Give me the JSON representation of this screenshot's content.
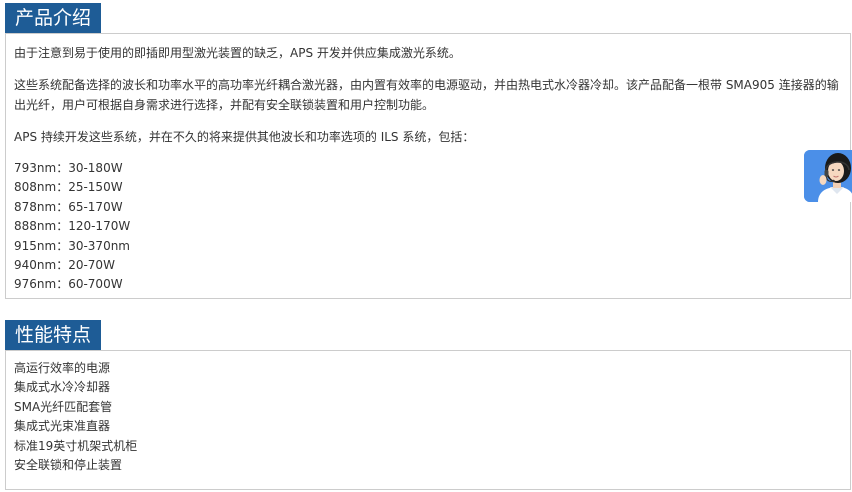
{
  "intro": {
    "title": "产品介绍",
    "paragraphs": [
      "由于注意到易于使用的即插即用型激光装置的缺乏，APS 开发并供应集成激光系统。",
      "这些系统配备选择的波长和功率水平的高功率光纤耦合激光器，由内置有效率的电源驱动，并由热电式水冷器冷却。该产品配备一根带 SMA905 连接器的输出光纤，用户可根据自身需求进行选择，并配有安全联锁装置和用户控制功能。",
      "APS 持续开发这些系统，并在不久的将来提供其他波长和功率选项的 ILS 系统，包括："
    ],
    "specs": [
      "793nm：30-180W",
      "808nm：25-150W",
      "878nm：65-170W",
      "888nm：120-170W",
      "915nm：30-370nm",
      "940nm：20-70W",
      "976nm：60-700W"
    ]
  },
  "features": {
    "title": "性能特点",
    "items": [
      "高运行效率的电源",
      "集成式水冷冷却器",
      "SMA光纤匹配套管",
      "集成式光束准直器",
      "标准19英寸机架式机柜",
      "安全联锁和停止装置"
    ]
  },
  "colors": {
    "tab_background": "#1e5c96",
    "tab_text": "#ffffff",
    "border": "#cccccc",
    "body_text": "#333333",
    "service_widget": "#4b8fe8"
  },
  "widgets": {
    "service_icon": "customer-service-agent-icon"
  }
}
